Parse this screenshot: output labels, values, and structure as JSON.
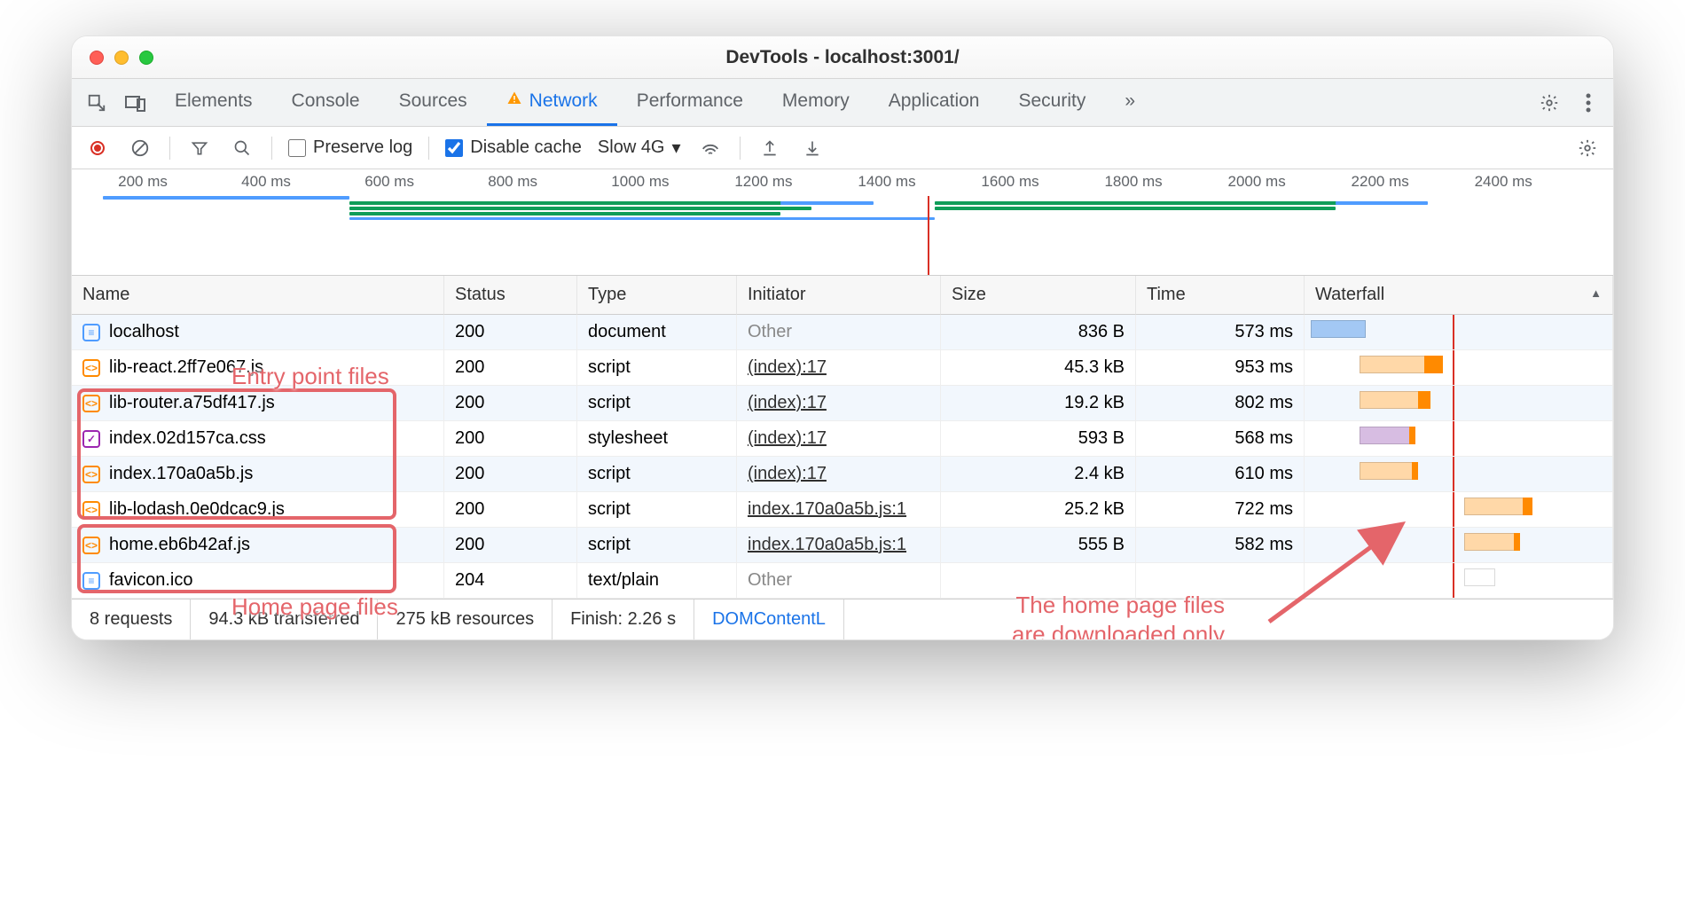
{
  "window": {
    "title": "DevTools - localhost:3001/"
  },
  "tabs": {
    "items": [
      "Elements",
      "Console",
      "Sources",
      "Network",
      "Performance",
      "Memory",
      "Application",
      "Security"
    ],
    "active": "Network",
    "overflow_glyph": "»"
  },
  "toolbar": {
    "preserve_log_label": "Preserve log",
    "preserve_log_checked": false,
    "disable_cache_label": "Disable cache",
    "disable_cache_checked": true,
    "throttle_value": "Slow 4G"
  },
  "timeline": {
    "ticks_ms": [
      200,
      400,
      600,
      800,
      1000,
      1200,
      1400,
      1600,
      1800,
      2000,
      2200,
      2400
    ]
  },
  "columns": {
    "name": "Name",
    "status": "Status",
    "type": "Type",
    "initiator": "Initiator",
    "size": "Size",
    "time": "Time",
    "waterfall": "Waterfall"
  },
  "rows": [
    {
      "icon": "doc",
      "name": "localhost",
      "status": "200",
      "type": "document",
      "initiator": "Other",
      "initiator_other": true,
      "size": "836 B",
      "time": "573 ms",
      "wf": {
        "start": 2,
        "len": 18,
        "kind": "blue",
        "cap": 0
      }
    },
    {
      "icon": "js",
      "name": "lib-react.2ff7e067.js",
      "status": "200",
      "type": "script",
      "initiator": "(index):17",
      "size": "45.3 kB",
      "time": "953 ms",
      "wf": {
        "start": 18,
        "len": 27,
        "kind": "orange",
        "cap": 6
      }
    },
    {
      "icon": "js",
      "name": "lib-router.a75df417.js",
      "status": "200",
      "type": "script",
      "initiator": "(index):17",
      "size": "19.2 kB",
      "time": "802 ms",
      "wf": {
        "start": 18,
        "len": 23,
        "kind": "orange",
        "cap": 4
      }
    },
    {
      "icon": "css",
      "name": "index.02d157ca.css",
      "status": "200",
      "type": "stylesheet",
      "initiator": "(index):17",
      "size": "593 B",
      "time": "568 ms",
      "wf": {
        "start": 18,
        "len": 18,
        "kind": "purple",
        "cap": 2
      }
    },
    {
      "icon": "js",
      "name": "index.170a0a5b.js",
      "status": "200",
      "type": "script",
      "initiator": "(index):17",
      "size": "2.4 kB",
      "time": "610 ms",
      "wf": {
        "start": 18,
        "len": 19,
        "kind": "orange",
        "cap": 2
      }
    },
    {
      "icon": "js",
      "name": "lib-lodash.0e0dcac9.js",
      "status": "200",
      "type": "script",
      "initiator": "index.170a0a5b.js:1",
      "size": "25.2 kB",
      "time": "722 ms",
      "wf": {
        "start": 52,
        "len": 22,
        "kind": "orange",
        "cap": 3
      }
    },
    {
      "icon": "js",
      "name": "home.eb6b42af.js",
      "status": "200",
      "type": "script",
      "initiator": "index.170a0a5b.js:1",
      "size": "555 B",
      "time": "582 ms",
      "wf": {
        "start": 52,
        "len": 18,
        "kind": "orange",
        "cap": 2
      }
    },
    {
      "icon": "doc",
      "name": "favicon.ico",
      "status": "204",
      "type": "text/plain",
      "initiator": "Other",
      "initiator_other": true,
      "size": "",
      "time": "",
      "wf": {
        "start": 52,
        "len": 10,
        "kind": "white",
        "cap": 0
      }
    }
  ],
  "status_bar": {
    "requests": "8 requests",
    "transferred": "94.3 kB transferred",
    "resources": "275 kB resources",
    "finish": "Finish: 2.26 s",
    "domcontent": "DOMContentL"
  },
  "annotations": {
    "entry_label": "Entry point files",
    "home_label": "Home page files",
    "explain": "The home page files\nare downloaded only\nafter the entry point\nis fully loaded"
  }
}
